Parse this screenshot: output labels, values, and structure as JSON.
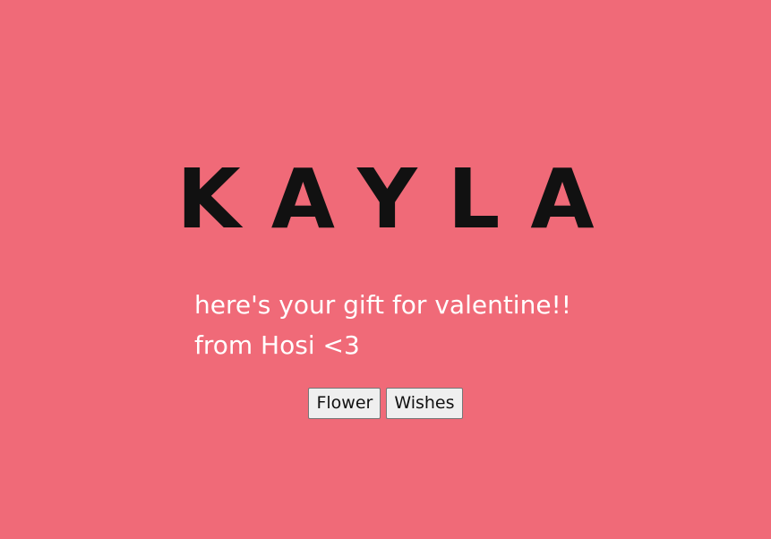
{
  "page": {
    "background_color": "#f06a78",
    "text_color_title": "#111111",
    "text_color_message": "#ffffff"
  },
  "title": "KAYLA",
  "message": {
    "line1": "here's your gift for valentine!!",
    "line2": "from Hosi <3"
  },
  "buttons": {
    "flower_label": "Flower",
    "wishes_label": "Wishes"
  }
}
